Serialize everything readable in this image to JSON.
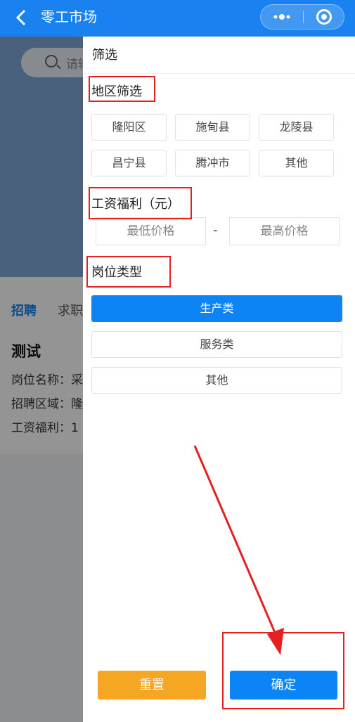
{
  "nav": {
    "back_icon": "chevron-left-icon",
    "title": "零工市场"
  },
  "background": {
    "search_placeholder": "请输",
    "tabs": [
      "招聘",
      "求职"
    ],
    "card": {
      "title": "测试",
      "lines": [
        "岗位名称：采",
        "招聘区域：隆",
        "工资福利：1"
      ]
    }
  },
  "filter": {
    "title": "筛选",
    "region": {
      "label": "地区筛选",
      "options": [
        "隆阳区",
        "施甸县",
        "龙陵县",
        "昌宁县",
        "腾冲市",
        "其他"
      ]
    },
    "salary": {
      "label": "工资福利（元）",
      "min_placeholder": "最低价格",
      "separator": "-",
      "max_placeholder": "最高价格"
    },
    "job_type": {
      "label": "岗位类型",
      "options": [
        "生产类",
        "服务类",
        "其他"
      ],
      "selected": "生产类"
    },
    "reset_label": "重置",
    "confirm_label": "确定"
  },
  "colors": {
    "nav_blue": "#1a82f0",
    "primary": "#0d84f6",
    "reset_orange": "#f5a623",
    "annotation_red": "#e52020"
  }
}
